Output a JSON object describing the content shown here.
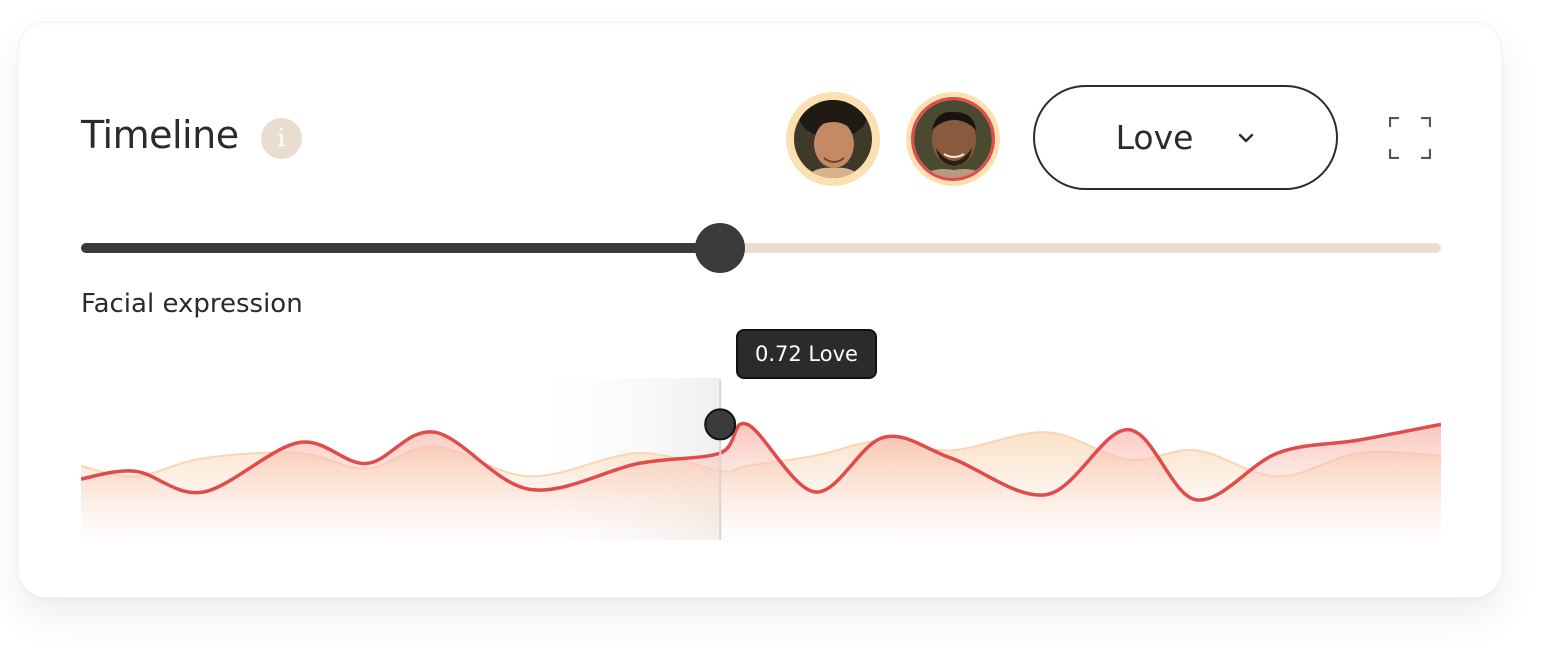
{
  "header": {
    "title": "Timeline",
    "info_icon": "info-icon",
    "info_glyph": "i"
  },
  "participants": [
    {
      "name": "avatar-woman",
      "ring_color": "#fbe0b0"
    },
    {
      "name": "avatar-man",
      "ring_color": "#e04c4c"
    }
  ],
  "emotion_select": {
    "selected": "Love",
    "icon": "chevron-down-icon"
  },
  "fullscreen_icon": "fullscreen-icon",
  "timeline": {
    "progress": 0.47
  },
  "section": {
    "label": "Facial expression"
  },
  "tooltip": {
    "text": "0.72 Love"
  },
  "colors": {
    "accent_line": "#e04c4c",
    "secondary_line": "#f9d6b5",
    "track_bg": "#eaded3",
    "track_fill": "#3b3b3b",
    "text": "#2b2b2b"
  },
  "chart_data": {
    "type": "area",
    "x": [
      0,
      0.04,
      0.09,
      0.16,
      0.21,
      0.26,
      0.33,
      0.41,
      0.47,
      0.49,
      0.54,
      0.59,
      0.64,
      0.71,
      0.77,
      0.82,
      0.88,
      0.94,
      1.0
    ],
    "series": [
      {
        "values": [
          0.3,
          0.36,
          0.2,
          0.58,
          0.42,
          0.66,
          0.22,
          0.42,
          0.5,
          0.72,
          0.2,
          0.62,
          0.46,
          0.18,
          0.68,
          0.14,
          0.5,
          0.6,
          0.72
        ]
      },
      {
        "values": [
          0.4,
          0.32,
          0.46,
          0.5,
          0.38,
          0.55,
          0.32,
          0.5,
          0.36,
          0.4,
          0.48,
          0.6,
          0.52,
          0.66,
          0.45,
          0.52,
          0.32,
          0.5,
          0.48
        ]
      }
    ],
    "highlight_x": 0.47,
    "highlight_value": 0.72,
    "ylim": [
      0,
      1
    ]
  }
}
